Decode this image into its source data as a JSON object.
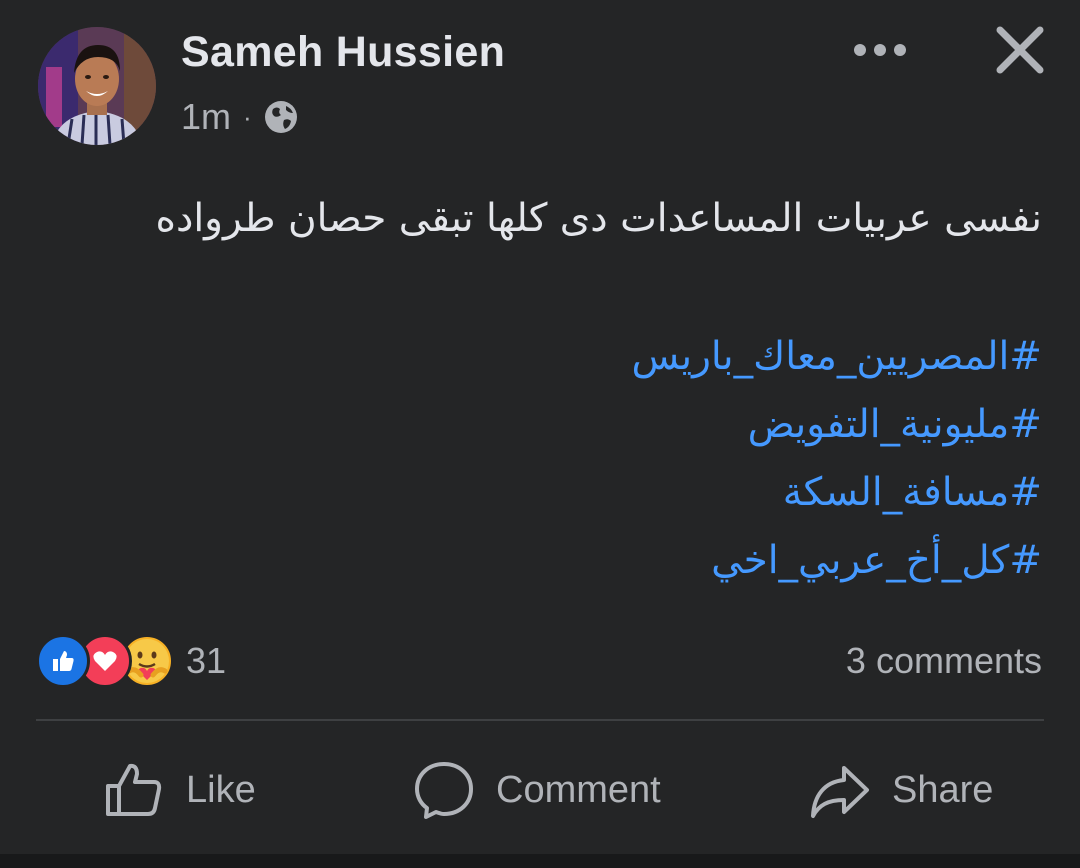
{
  "post": {
    "author": "Sameh Hussien",
    "time": "1m",
    "separator": "·",
    "privacy_icon": "globe-icon",
    "body": "نفسى عربيات المساعدات دى كلها تبقى حصان طرواده",
    "hashtags": [
      "#المصريين_معاك_باريس",
      "#مليونية_التفويض",
      "#مسافة_السكة",
      "#كل_أخ_عربي_اخي"
    ]
  },
  "reactions": {
    "icons": [
      "like-reaction-icon",
      "love-reaction-icon",
      "care-reaction-icon"
    ],
    "count": "31"
  },
  "comments": {
    "label": "3 comments"
  },
  "actions": {
    "like": "Like",
    "comment": "Comment",
    "share": "Share"
  },
  "colors": {
    "background": "#242526",
    "text": "#e4e6eb",
    "secondary_text": "#b0b3b8",
    "hashtag": "#4599ff",
    "like_blue": "#1b74e4",
    "love_red": "#f33e58",
    "care_yellow": "#f7b125"
  }
}
